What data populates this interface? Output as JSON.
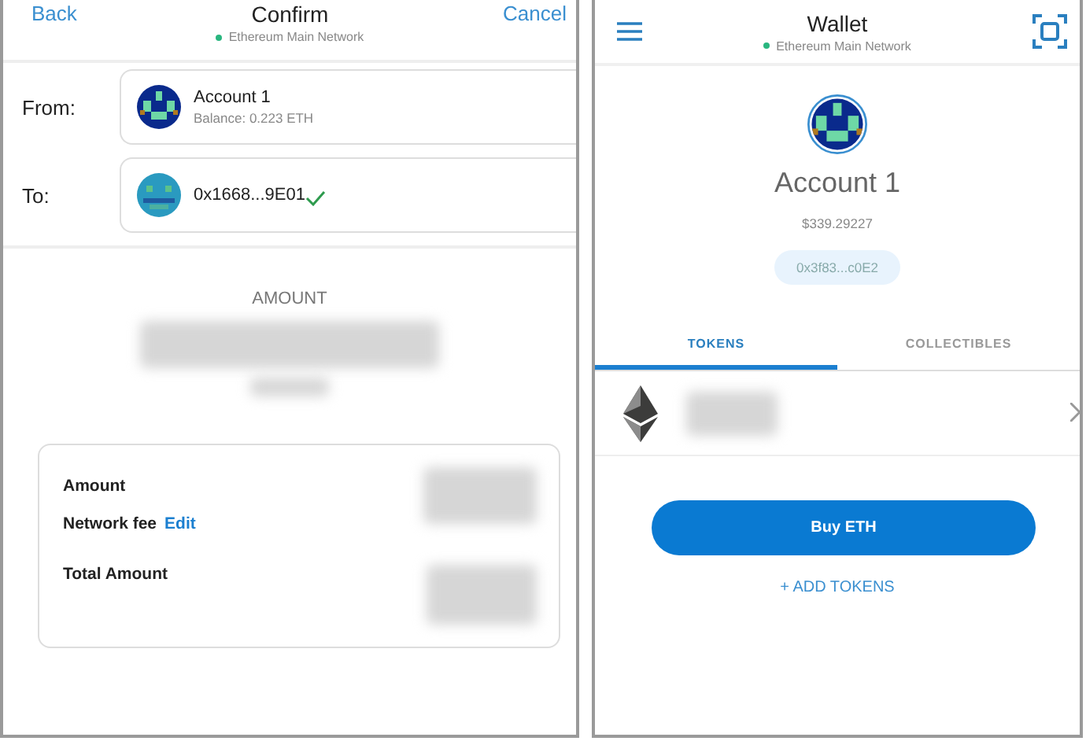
{
  "confirm": {
    "header": {
      "back": "Back",
      "title": "Confirm",
      "network": "Ethereum Main Network",
      "cancel": "Cancel"
    },
    "from": {
      "label": "From:",
      "account_name": "Account 1",
      "balance": "Balance: 0.223 ETH"
    },
    "to": {
      "label": "To:",
      "address": "0x1668...9E01",
      "verified": true
    },
    "amount_label": "AMOUNT",
    "summary": {
      "rows": [
        {
          "label": "Amount"
        },
        {
          "label": "Network fee",
          "link": "Edit"
        }
      ],
      "total_label": "Total Amount"
    }
  },
  "wallet": {
    "header": {
      "title": "Wallet",
      "network": "Ethereum Main Network"
    },
    "account_name": "Account 1",
    "fiat_balance": "$339.29227",
    "address": "0x3f83...c0E2",
    "tabs": [
      {
        "label": "TOKENS",
        "selected": true
      },
      {
        "label": "COLLECTIBLES",
        "selected": false
      }
    ],
    "buy_button": "Buy ETH",
    "add_tokens": "+ ADD TOKENS"
  }
}
